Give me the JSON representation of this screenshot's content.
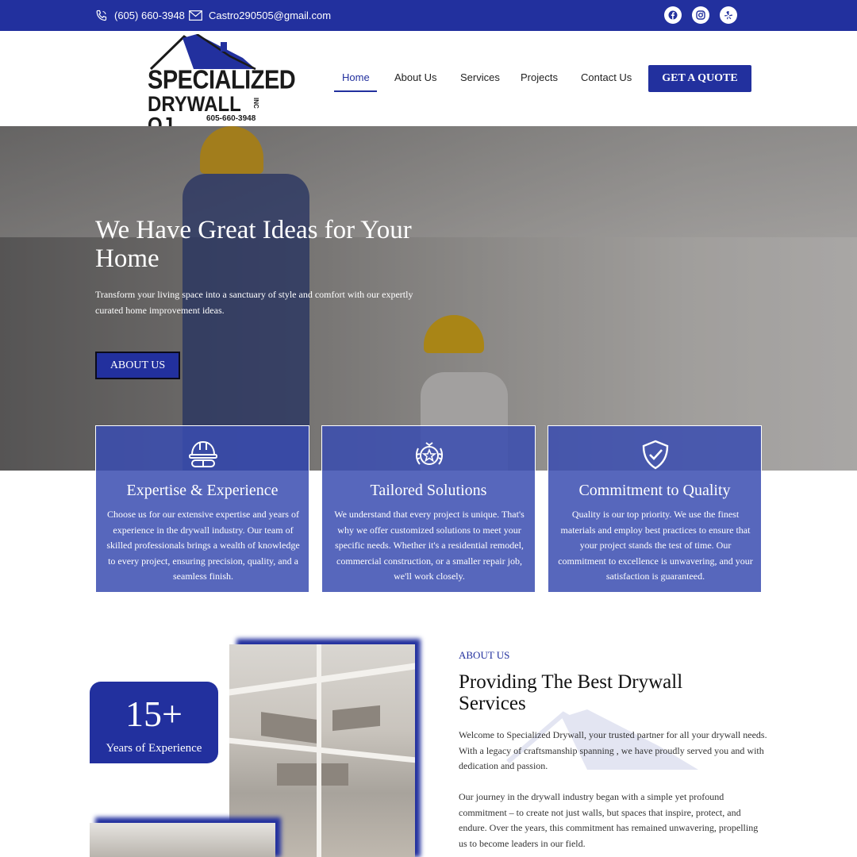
{
  "topbar": {
    "phone": "(605) 660-3948",
    "email": "Castro290505@gmail.com",
    "social": [
      "facebook-icon",
      "instagram-icon",
      "yelp-icon"
    ]
  },
  "logo": {
    "line1": "SPECIALIZED",
    "line2": "DRYWALL OJ",
    "suffix": "INC",
    "phone": "605-660-3948"
  },
  "nav": {
    "items": [
      "Home",
      "About Us",
      "Services",
      "Projects",
      "Contact Us"
    ],
    "active": "Home",
    "cta": "GET A QUOTE"
  },
  "hero": {
    "title": "We Have Great Ideas for Your Home",
    "subtitle": "Transform your living space into a sanctuary of style and comfort with our expertly curated home improvement ideas.",
    "button": "ABOUT US"
  },
  "features": [
    {
      "icon": "hard-hat-icon",
      "title": "Expertise & Experience",
      "body": "Choose us for our extensive expertise and years of experience in the drywall industry. Our team of skilled professionals brings a wealth of knowledge to every project, ensuring precision, quality, and a seamless finish."
    },
    {
      "icon": "laurel-star-icon",
      "title": "Tailored Solutions",
      "body": "We understand that every project is unique. That's why we offer customized solutions to meet your specific needs. Whether it's a residential remodel, commercial construction, or a smaller repair job, we'll work closely."
    },
    {
      "icon": "shield-check-icon",
      "title": "Commitment to Quality",
      "body": "Quality is our top priority. We use the finest materials and employ best practices to ensure that your project stands the test of time. Our commitment to excellence is unwavering, and your satisfaction is guaranteed."
    }
  ],
  "experience": {
    "number": "15+",
    "label": "Years of Experience"
  },
  "about": {
    "eyebrow": "ABOUT US",
    "title": "Providing The Best Drywall Services",
    "paragraph1": "Welcome to Specialized Drywall, your trusted partner for all your drywall needs. With a legacy of craftsmanship spanning , we have proudly served you and with dedication and passion.",
    "paragraph2": "Our journey in the drywall industry began with a simple yet profound commitment – to create not just walls, but spaces that inspire, protect, and endure. Over the years, this commitment has remained unwavering, propelling us to become leaders in our field."
  },
  "colors": {
    "brand": "#22309e",
    "card": "#394cb0"
  }
}
